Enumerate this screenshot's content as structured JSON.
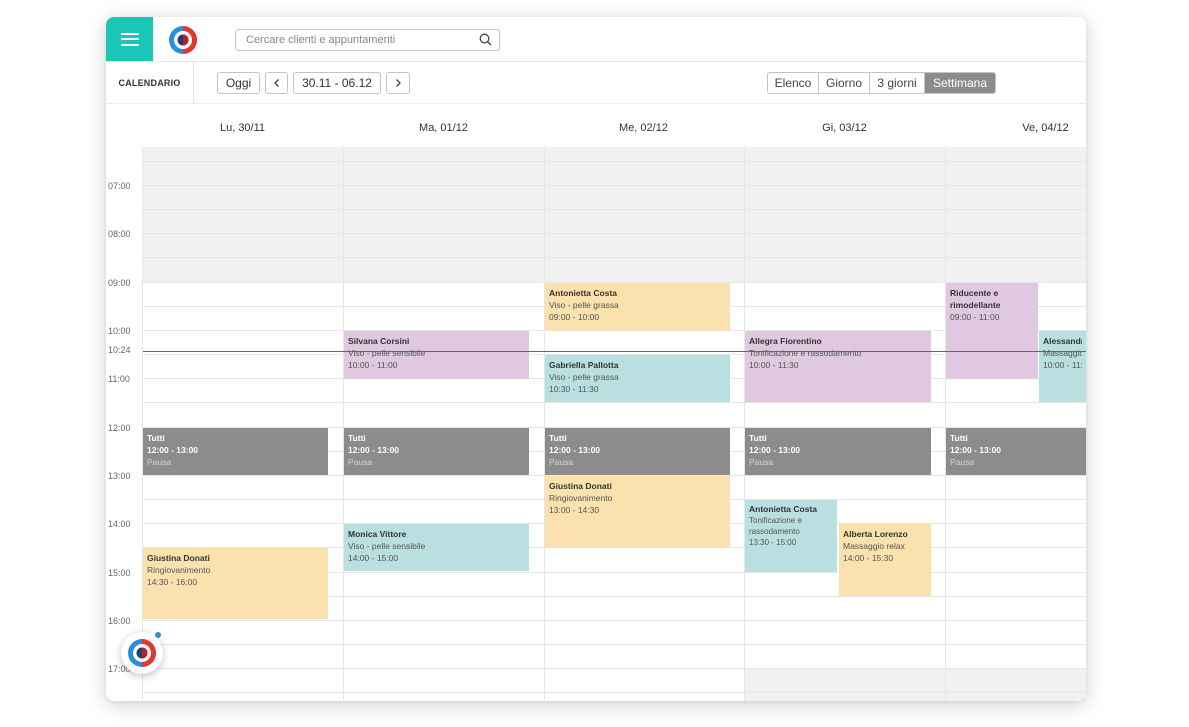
{
  "header": {
    "search_placeholder": "Cercare clienti e appuntamenti"
  },
  "toolbar": {
    "section_title": "CALENDARIO",
    "today_label": "Oggi",
    "prev_icon": "chevron-left-icon",
    "next_icon": "chevron-right-icon",
    "range_label": "30.11 - 06.12",
    "views": [
      "Elenco",
      "Giorno",
      "3 giorni",
      "Settimana"
    ],
    "active_view": "Settimana"
  },
  "days": [
    "Lu, 30/11",
    "Ma, 01/12",
    "Me, 02/12",
    "Gi, 03/12",
    "Ve, 04/12"
  ],
  "hours": [
    "07:00",
    "08:00",
    "09:00",
    "10:00",
    "11:00",
    "12:00",
    "13:00",
    "14:00",
    "15:00",
    "16:00",
    "17:00"
  ],
  "now_label": "10:24",
  "events": [
    {
      "title": "Antonietta Costa",
      "desc": "Viso - pelle grassa",
      "time": "09:00 - 10:00",
      "color": "#fae1ad"
    },
    {
      "title": "Riducente e rimodellante",
      "desc": "",
      "time": "09:00 - 11:00",
      "color": "#dfc8e0"
    },
    {
      "title": "Silvana Corsini",
      "desc": "Viso - pelle sensibile",
      "time": "10:00 - 11:00",
      "color": "#dfc8e0"
    },
    {
      "title": "Allegra Fiorentino",
      "desc": "Tonificazione e rassodamento",
      "time": "10:00 - 11:30",
      "color": "#dfc8e0"
    },
    {
      "title": "Alessandra",
      "desc": "Massaggio re",
      "time": "10:00 - 11:",
      "color": "#b9dfe0"
    },
    {
      "title": "Gabriella Pallotta",
      "desc": "Viso - pelle grassa",
      "time": "10:30 - 11:30",
      "color": "#b9dfe0"
    },
    {
      "title": "Tutti",
      "desc": "Pausa",
      "time": "12:00 - 13:00",
      "color": "#8c8c8c"
    },
    {
      "title": "Giustina Donati",
      "desc": "Ringiovanimento",
      "time": "13:00 - 14:30",
      "color": "#fae1ad"
    },
    {
      "title": "Antonietta Costa",
      "desc": "Tonificazione e rassodamento",
      "time": "13:30 - 15:00",
      "color": "#b9dfe0"
    },
    {
      "title": "Monica Vittore",
      "desc": "Viso - pelle sensibile",
      "time": "14:00 - 15:00",
      "color": "#b9dfe0"
    },
    {
      "title": "Alberta Lorenzo",
      "desc": "Massaggio relax",
      "time": "14:00 - 15:30",
      "color": "#fae1ad"
    },
    {
      "title": "Giustina Donati",
      "desc": "Ringiovanimento",
      "time": "14:30 - 16:00",
      "color": "#fae1ad"
    }
  ],
  "colors": {
    "accent": "#1cc6b6",
    "closed_bg": "#f0f1f3",
    "grid_line": "#e6e6e6"
  }
}
